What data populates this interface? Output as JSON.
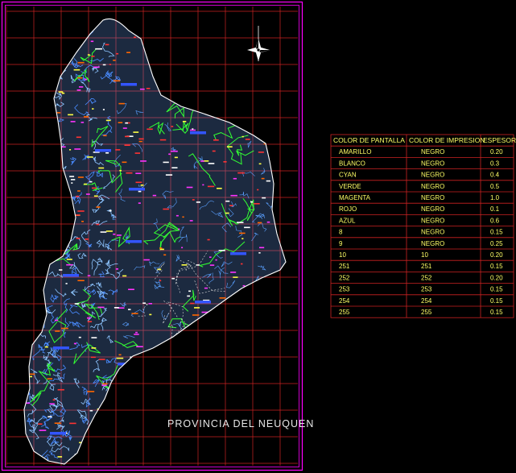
{
  "map": {
    "title": "PROVINCIA DEL NEUQUEN"
  },
  "colors": {
    "background": "#000000",
    "frame": "#ff00ff",
    "grid": "#cc2222",
    "rivers": "#66aaff",
    "roads": "#33ff33",
    "table_border": "#cc2222",
    "table_text": "#ffff66",
    "title_text": "#e8e8e8"
  },
  "icons": {
    "north_arrow": "north-arrow-compass-icon"
  },
  "legend_table": {
    "headers": [
      "COLOR DE PANTALLA",
      "COLOR DE IMPRESION",
      "ESPESOR"
    ],
    "rows": [
      [
        "AMARILLO",
        "NEGRO",
        "0.20"
      ],
      [
        "BLANCO",
        "NEGRO",
        "0.3"
      ],
      [
        "CYAN",
        "NEGRO",
        "0.4"
      ],
      [
        "VERDE",
        "NEGRO",
        "0.5"
      ],
      [
        "MAGENTA",
        "NEGRO",
        "1.0"
      ],
      [
        "ROJO",
        "NEGRO",
        "0.1"
      ],
      [
        "AZUL",
        "NEGRO",
        "0.6"
      ],
      [
        "8",
        "NEGRO",
        "0.15"
      ],
      [
        "9",
        "NEGRO",
        "0.25"
      ],
      [
        "10",
        "10",
        "0.20"
      ],
      [
        "251",
        "251",
        "0.15"
      ],
      [
        "252",
        "252",
        "0.20"
      ],
      [
        "253",
        "253",
        "0.15"
      ],
      [
        "254",
        "254",
        "0.15"
      ],
      [
        "255",
        "255",
        "0.15"
      ]
    ]
  }
}
